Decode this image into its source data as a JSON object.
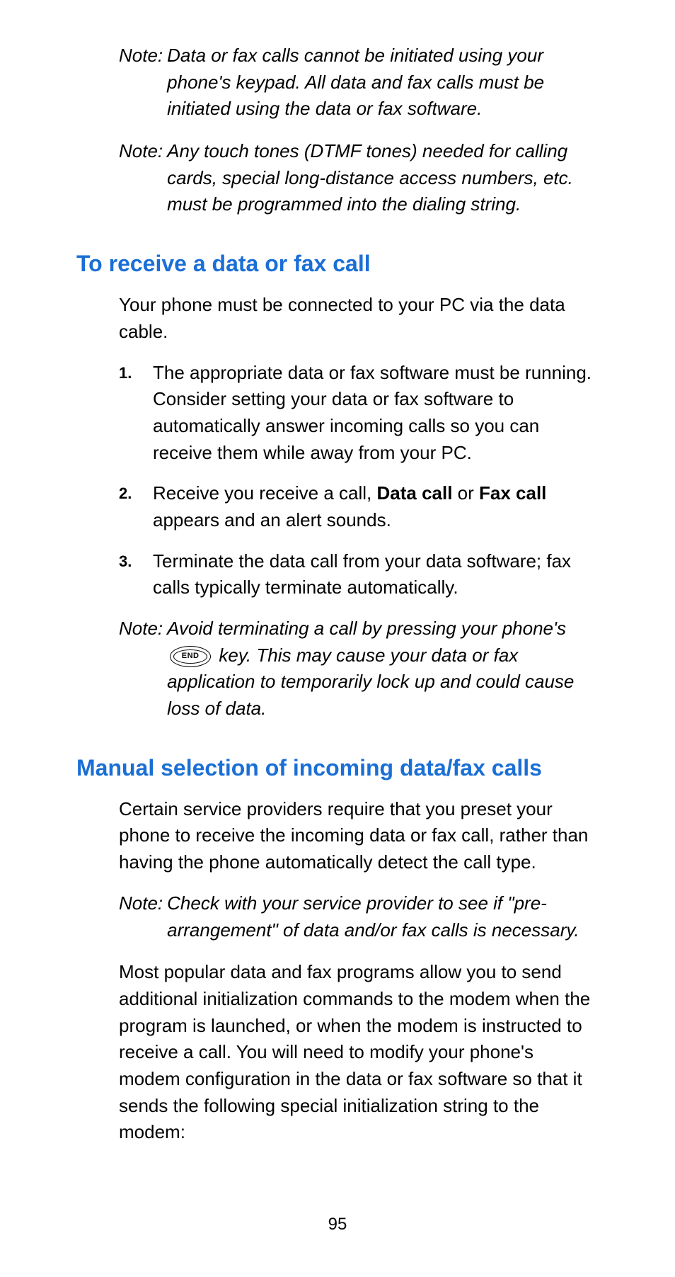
{
  "notes_top": [
    {
      "label": "Note:",
      "text": "Data or fax calls cannot be initiated using your phone's keypad. All data and fax calls must be initiated using the data or fax software."
    },
    {
      "label": "Note:",
      "text": "Any touch tones (DTMF tones) needed for calling cards, special long-distance access numbers, etc. must be programmed into the dialing string."
    }
  ],
  "section1": {
    "heading": "To receive a data or fax call",
    "intro": "Your phone must be connected to your PC via the data cable.",
    "steps": [
      {
        "num": "1.",
        "text": "The appropriate data or fax software must be running. Consider setting your data or fax software to automatically answer incoming calls so you can receive them while away from your PC."
      },
      {
        "num": "2.",
        "prefix": "Receive you receive a call, ",
        "bold1": "Data call",
        "mid": " or ",
        "bold2": "Fax call",
        "suffix": " appears and an alert sounds."
      },
      {
        "num": "3.",
        "text": "Terminate the data call from your data software; fax calls typically terminate automatically."
      }
    ],
    "note": {
      "label": "Note:",
      "pre": "Avoid terminating a call by pressing your phone's ",
      "key_label": "END",
      "post": " key. This may cause your data or fax application to temporarily lock up and could cause loss of data."
    }
  },
  "section2": {
    "heading": "Manual selection of incoming data/fax calls",
    "p1": "Certain service providers require that you preset your phone to receive the incoming data or fax call, rather than having the phone automatically detect the call type.",
    "note": {
      "label": "Note:",
      "text": "Check with your service provider to see if \"pre-arrangement\" of data and/or fax calls is necessary."
    },
    "p2": "Most popular data and fax programs allow you to send additional initialization commands to the modem when the program is launched, or when the modem is instructed to receive a call. You will need to modify your phone's modem configuration in the data or fax software so that it sends the following special initialization string to the modem:"
  },
  "page_number": "95"
}
